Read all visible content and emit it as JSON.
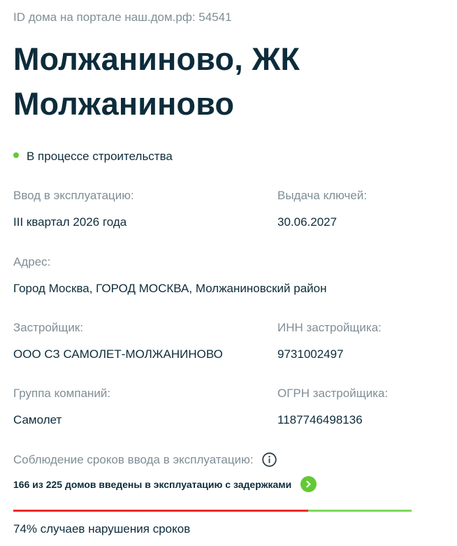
{
  "portal_id": "ID дома на портале наш.дом.рф: 54541",
  "title": "Молжаниново, ЖК Молжаниново",
  "status": {
    "text": "В процессе строительства",
    "color": "#63c934"
  },
  "fields": {
    "commissioning": {
      "label": "Ввод в эксплуатацию:",
      "value": "III квартал 2026 года"
    },
    "keys": {
      "label": "Выдача ключей:",
      "value": "30.06.2027"
    },
    "address": {
      "label": "Адрес:",
      "value": "Город Москва, ГОРОД МОСКВА, Молжаниновский район"
    },
    "developer": {
      "label": "Застройщик:",
      "value": "ООО СЗ САМОЛЕТ-МОЛЖАНИНОВО"
    },
    "inn": {
      "label": "ИНН застройщика:",
      "value": "9731002497"
    },
    "group": {
      "label": "Группа компаний:",
      "value": "Самолет"
    },
    "ogrn": {
      "label": "ОГРН застройщика:",
      "value": "1187746498136"
    }
  },
  "compliance": {
    "label": "Соблюдение сроков ввода в эксплуатацию:",
    "info_icon": "info-icon",
    "delay_text": "166 из 225 домов введены в эксплуатацию с задержками",
    "arrow_icon": "chevron-right-icon",
    "delayed_count": 166,
    "total_count": 225,
    "delayed_fraction": 0.74,
    "delayed_color": "#ee2a2a",
    "on_time_color": "#7ed957",
    "violation_text": "74% случаев нарушения сроков"
  }
}
